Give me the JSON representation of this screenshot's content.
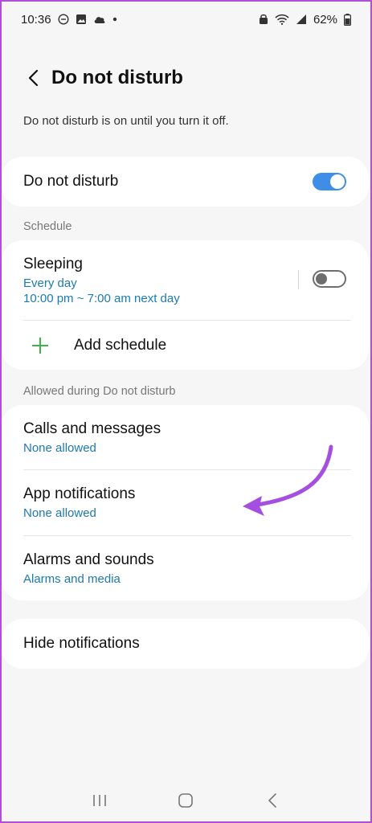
{
  "status_bar": {
    "time": "10:36",
    "battery": "62%"
  },
  "header": {
    "back_icon": "chevron-left-icon",
    "title": "Do not disturb"
  },
  "subtitle": "Do not disturb is on until you turn it off.",
  "dnd_toggle": {
    "label": "Do not disturb",
    "state": "on",
    "accent_color": "#3e8de6"
  },
  "schedule": {
    "section_label": "Schedule",
    "items": [
      {
        "label": "Sleeping",
        "repeat": "Every day",
        "time_range": "10:00 pm ~ 7:00 am next day",
        "enabled": false
      }
    ],
    "add_label": "Add schedule",
    "add_icon_color": "#3db54a"
  },
  "allowed": {
    "section_label": "Allowed during Do not disturb",
    "items": [
      {
        "label": "Calls and messages",
        "value": "None allowed"
      },
      {
        "label": "App notifications",
        "value": "None allowed"
      },
      {
        "label": "Alarms and sounds",
        "value": "Alarms and media"
      }
    ]
  },
  "hide_notifications": {
    "label": "Hide notifications"
  },
  "annotation": {
    "arrow_color": "#a44fe0"
  },
  "nav_bar": {
    "icons": [
      "recents-icon",
      "home-icon",
      "back-icon"
    ]
  }
}
